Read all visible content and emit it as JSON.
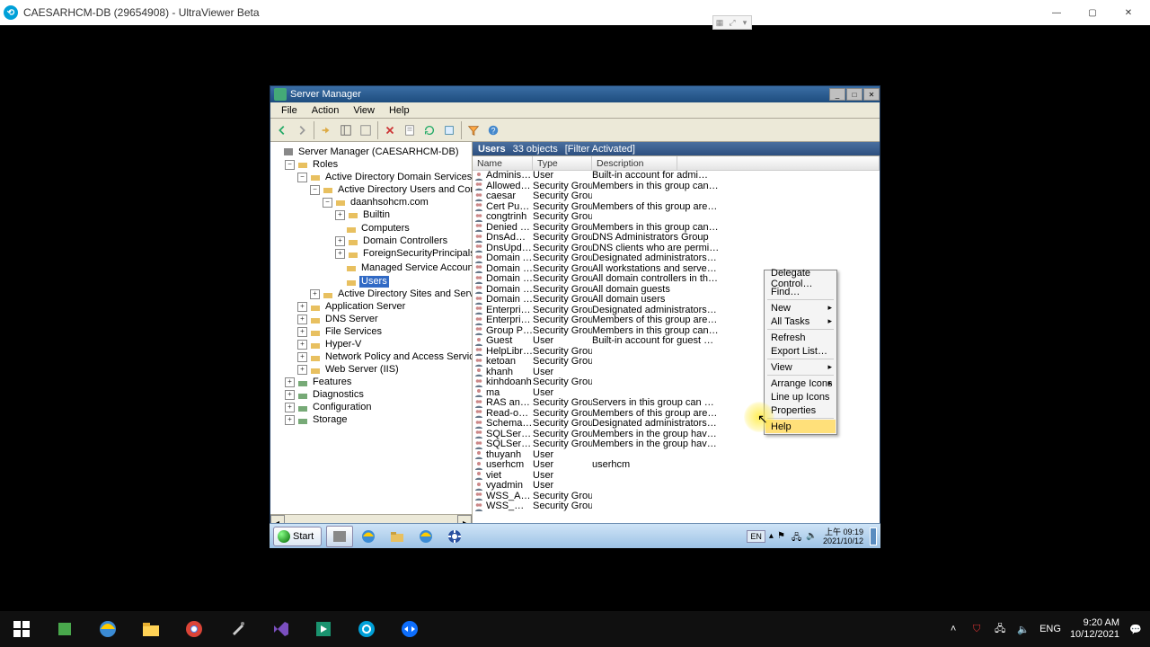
{
  "uv": {
    "title": "CAESARHCM-DB (29654908) - UltraViewer Beta"
  },
  "sm": {
    "title": "Server Manager",
    "menus": [
      "File",
      "Action",
      "View",
      "Help"
    ],
    "tree_root": "Server Manager (CAESARHCM-DB)",
    "tree": {
      "roles": "Roles",
      "adds": "Active Directory Domain Services",
      "aduc": "Active Directory Users and Computers [ CaesarHCM",
      "domain": "daanhsohcm.com",
      "builtin": "Builtin",
      "computers": "Computers",
      "dc": "Domain Controllers",
      "fsp": "ForeignSecurityPrincipals",
      "msa": "Managed Service Accounts",
      "users": "Users",
      "adss": "Active Directory Sites and Services",
      "appserver": "Application Server",
      "dns": "DNS Server",
      "fileservices": "File Services",
      "hyperv": "Hyper-V",
      "npas": "Network Policy and Access Services",
      "iis": "Web Server (IIS)",
      "features": "Features",
      "diagnostics": "Diagnostics",
      "configuration": "Configuration",
      "storage": "Storage"
    },
    "list": {
      "title": "Users",
      "count": "33 objects",
      "filter": "[Filter Activated]",
      "cols": {
        "name": "Name",
        "type": "Type",
        "desc": "Description"
      },
      "rows": [
        {
          "i": "u",
          "n": "Administrator",
          "t": "User",
          "d": "Built-in account for admi…"
        },
        {
          "i": "g",
          "n": "Allowed ROD…",
          "t": "Security Group …",
          "d": "Members in this group can…"
        },
        {
          "i": "g",
          "n": "caesar",
          "t": "Security Group …",
          "d": ""
        },
        {
          "i": "g",
          "n": "Cert Publishers",
          "t": "Security Group …",
          "d": "Members of this group are…"
        },
        {
          "i": "g",
          "n": "congtrinh",
          "t": "Security Group …",
          "d": ""
        },
        {
          "i": "g",
          "n": "Denied ROD…",
          "t": "Security Group …",
          "d": "Members in this group can…"
        },
        {
          "i": "g",
          "n": "DnsAdmins",
          "t": "Security Group …",
          "d": "DNS Administrators Group"
        },
        {
          "i": "g",
          "n": "DnsUpdatePr…",
          "t": "Security Group …",
          "d": "DNS clients who are permi…"
        },
        {
          "i": "g",
          "n": "Domain Admins",
          "t": "Security Group …",
          "d": "Designated administrators…"
        },
        {
          "i": "g",
          "n": "Domain Com…",
          "t": "Security Group …",
          "d": "All workstations and serve…"
        },
        {
          "i": "g",
          "n": "Domain Cont…",
          "t": "Security Group …",
          "d": "All domain controllers in th…"
        },
        {
          "i": "g",
          "n": "Domain Guests",
          "t": "Security Group …",
          "d": "All domain guests"
        },
        {
          "i": "g",
          "n": "Domain Users",
          "t": "Security Group …",
          "d": "All domain users"
        },
        {
          "i": "g",
          "n": "Enterprise A…",
          "t": "Security Group …",
          "d": "Designated administrators…"
        },
        {
          "i": "g",
          "n": "Enterprise R…",
          "t": "Security Group …",
          "d": "Members of this group are…"
        },
        {
          "i": "g",
          "n": "Group Policy …",
          "t": "Security Group …",
          "d": "Members in this group can…"
        },
        {
          "i": "u",
          "n": "Guest",
          "t": "User",
          "d": "Built-in account for guest …"
        },
        {
          "i": "g",
          "n": "HelpLibraryU…",
          "t": "Security Group …",
          "d": ""
        },
        {
          "i": "g",
          "n": "ketoan",
          "t": "Security Group …",
          "d": ""
        },
        {
          "i": "u",
          "n": "khanh",
          "t": "User",
          "d": ""
        },
        {
          "i": "g",
          "n": "kinhdoanh",
          "t": "Security Group …",
          "d": ""
        },
        {
          "i": "u",
          "n": "ma",
          "t": "User",
          "d": ""
        },
        {
          "i": "g",
          "n": "RAS and IAS …",
          "t": "Security Group …",
          "d": "Servers in this group can …"
        },
        {
          "i": "g",
          "n": "Read-only D…",
          "t": "Security Group …",
          "d": "Members of this group are…"
        },
        {
          "i": "g",
          "n": "Schema Admins",
          "t": "Security Group …",
          "d": "Designated administrators…"
        },
        {
          "i": "g",
          "n": "SQLServer20…",
          "t": "Security Group …",
          "d": "Members in the group hav…"
        },
        {
          "i": "g",
          "n": "SQLServerM…",
          "t": "Security Group …",
          "d": "Members in the group hav…"
        },
        {
          "i": "u",
          "n": "thuyanh",
          "t": "User",
          "d": ""
        },
        {
          "i": "u",
          "n": "userhcm",
          "t": "User",
          "d": "userhcm"
        },
        {
          "i": "u",
          "n": "viet",
          "t": "User",
          "d": ""
        },
        {
          "i": "u",
          "n": "vyadmin",
          "t": "User",
          "d": ""
        },
        {
          "i": "g",
          "n": "WSS_ADMIN…",
          "t": "Security Group …",
          "d": ""
        },
        {
          "i": "g",
          "n": "WSS_WPG",
          "t": "Security Group …",
          "d": ""
        }
      ]
    }
  },
  "ctx": {
    "delegate": "Delegate Control…",
    "find": "Find…",
    "new": "New",
    "alltasks": "All Tasks",
    "refresh": "Refresh",
    "export": "Export List…",
    "view": "View",
    "arrange": "Arrange Icons",
    "lineup": "Line up Icons",
    "properties": "Properties",
    "help": "Help"
  },
  "innerbar": {
    "start": "Start",
    "lang": "EN",
    "time": "上午 09:19",
    "date": "2021/10/12"
  },
  "outerbar": {
    "time": "9:20 AM",
    "date": "10/12/2021",
    "lang": "ENG"
  }
}
